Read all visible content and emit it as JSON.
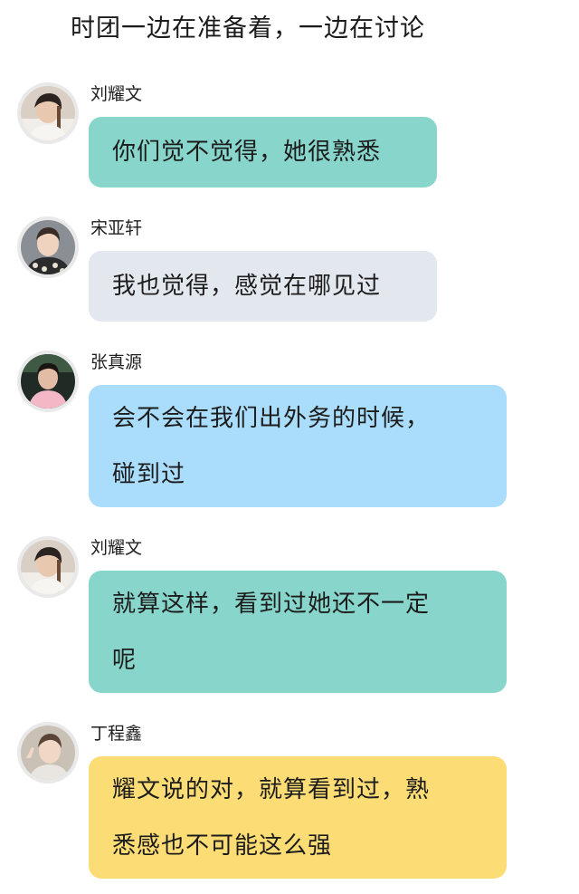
{
  "narration": "时团一边在准备着，一边在讨论",
  "messages": [
    {
      "sender": "刘耀文",
      "avatar_icon": "avatar-liu-yaowen-icon",
      "bubble_color": "#88d6cb",
      "lines": [
        "你们觉不觉得，她很熟悉"
      ]
    },
    {
      "sender": "宋亚轩",
      "avatar_icon": "avatar-song-yaxuan-icon",
      "bubble_color": "#e3e7ee",
      "lines": [
        "我也觉得，感觉在哪见过"
      ]
    },
    {
      "sender": "张真源",
      "avatar_icon": "avatar-zhang-zhenyuan-icon",
      "bubble_color": "#a9ddfb",
      "lines": [
        "会不会在我们出外务的时候，",
        "碰到过"
      ]
    },
    {
      "sender": "刘耀文",
      "avatar_icon": "avatar-liu-yaowen-icon",
      "bubble_color": "#88d6cb",
      "lines": [
        "就算这样，看到过她还不一定",
        "呢"
      ]
    },
    {
      "sender": "丁程鑫",
      "avatar_icon": "avatar-ding-chengxin-icon",
      "bubble_color": "#fcdc74",
      "lines": [
        "耀文说的对，就算看到过，熟",
        "悉感也不可能这么强"
      ]
    }
  ]
}
